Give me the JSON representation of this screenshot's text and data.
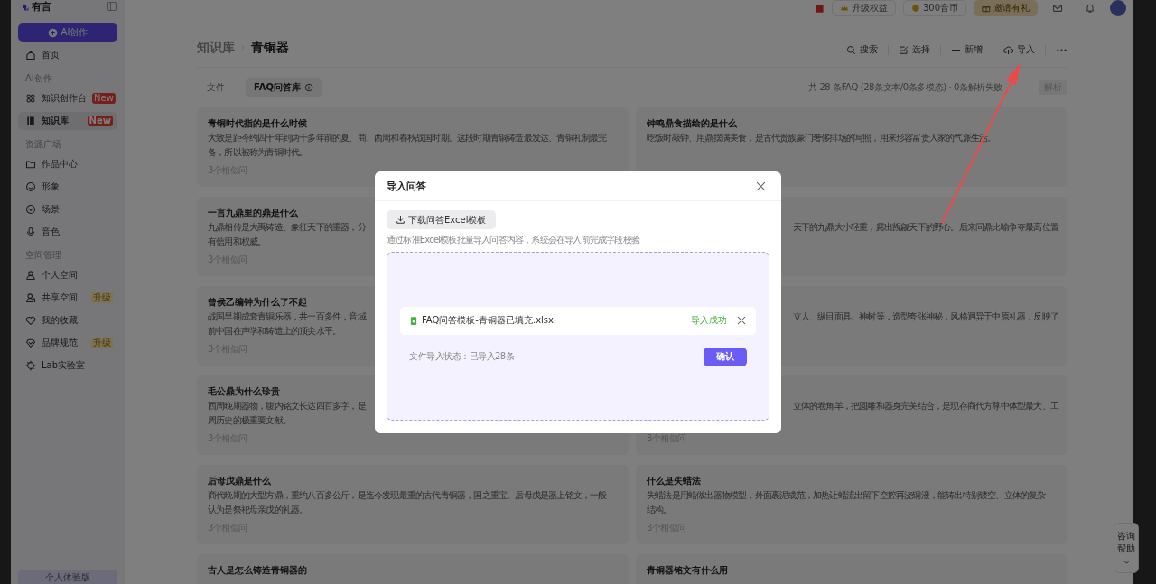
{
  "sidebar": {
    "logo": "有言",
    "create_button": "AI创作",
    "sections": [
      {
        "items": [
          {
            "label": "首页",
            "selected": false
          }
        ]
      },
      {
        "heading": "AI创作",
        "items": [
          {
            "label": "知识创作台",
            "selected": false,
            "badge": {
              "text": "New",
              "kind": "new"
            }
          },
          {
            "label": "知识库",
            "selected": true,
            "badge": {
              "text": "New",
              "kind": "new"
            }
          }
        ]
      },
      {
        "heading": "资源广场",
        "items": [
          {
            "label": "作品中心",
            "selected": false
          },
          {
            "label": "形象",
            "selected": false
          },
          {
            "label": "场景",
            "selected": false
          },
          {
            "label": "音色",
            "selected": false
          }
        ]
      },
      {
        "heading": "空间管理",
        "items": [
          {
            "label": "个人空间",
            "selected": false
          },
          {
            "label": "共享空间",
            "selected": false,
            "badge": {
              "text": "升级",
              "kind": "upgrade"
            }
          },
          {
            "label": "我的收藏",
            "selected": false
          },
          {
            "label": "品牌规范",
            "selected": false,
            "badge": {
              "text": "升级",
              "kind": "upgrade"
            }
          },
          {
            "label": "Lab实验室",
            "selected": false
          }
        ]
      }
    ],
    "plan": "个人体验版"
  },
  "top_bar": {
    "pills": [
      {
        "label": "升级权益",
        "kind": "plain"
      },
      {
        "label": "300音币",
        "kind": "plain"
      },
      {
        "label": "邀请有礼",
        "kind": "gold"
      }
    ]
  },
  "header": {
    "breadcrumb": [
      "知识库",
      "青铜器"
    ],
    "toolbar": [
      {
        "label": "搜索"
      },
      {
        "label": "选择"
      },
      {
        "label": "新增"
      },
      {
        "label": "导入"
      }
    ]
  },
  "tabs": [
    {
      "label": "文件",
      "selected": false
    },
    {
      "label": "FAQ问答库",
      "selected": true,
      "info": true
    }
  ],
  "stats": "共 28 条FAQ (28条文本/0条多模态) · 0条解析失败",
  "parse_button": {
    "label": "解析",
    "disabled": true
  },
  "cards": [
    {
      "title": "青铜时代指的是什么时候",
      "lines": [
        {
          "kind": "full",
          "text": "大致是距今约四千年到两千多年前的夏、商、西周和春秋战国时期。这段时期青铜铸造最发达、青铜礼制最完"
        },
        {
          "kind": "full",
          "text": "备，所以被称为青铜时代。"
        }
      ],
      "similar": "3个相似问"
    },
    {
      "title": "钟鸣鼎食描绘的是什么",
      "lines": [
        {
          "kind": "full",
          "text": "吃饭时敲钟、用鼎摆满美食，是古代贵族豪门奢侈排场的写照，用来形容富贵人家的气派生活。"
        }
      ]
    },
    {
      "title": "一言九鼎里的鼎是什么",
      "lines": [
        {
          "kind": "full",
          "text": "九鼎相传是大禹铸造、象征天下的重器，分"
        },
        {
          "kind": "full",
          "text": "有信用和权威。"
        }
      ],
      "similar": "3个相似问"
    },
    {
      "lines": [
        {
          "kind": "tail",
          "text": "天下的九鼎大小轻重，露出觊觎天下的野心。后来问鼎比喻争夺最高位置"
        }
      ]
    },
    {
      "title": "曾侯乙编钟为什么了不起",
      "lines": [
        {
          "kind": "full",
          "text": "战国早期成套青铜乐器，共一百多件，音域"
        },
        {
          "kind": "full",
          "text": "前中国在声学和铸造上的顶尖水平。"
        }
      ],
      "similar": "3个相似问"
    },
    {
      "lines": [
        {
          "kind": "tail",
          "text": "立人、纵目面具、神树等，造型夸张神秘，风格迥异于中原礼器，反映了"
        }
      ]
    },
    {
      "title": "毛公鼎为什么珍贵",
      "lines": [
        {
          "kind": "full",
          "text": "西周晚期器物，腹内铭文长达四百多字，是"
        },
        {
          "kind": "full",
          "text": "周历史的极重要文献。"
        }
      ],
      "similar": "3个相似问"
    },
    {
      "lines": [
        {
          "kind": "tail",
          "text": "立体的卷角羊，把圆雕和器身完美结合，是现存商代方尊中体型最大、工"
        }
      ],
      "similar": "3个相似问"
    },
    {
      "title": "后母戊鼎是什么",
      "lines": [
        {
          "kind": "full",
          "text": "商代晚期的大型方鼎，重约八百多公斤，是迄今发现最重的古代青铜器，国之重宝。后母戊是器上铭文，一般"
        },
        {
          "kind": "full",
          "text": "认为是祭祀母亲戊的礼器。"
        }
      ],
      "similar": "3个相似问"
    },
    {
      "title": "什么是失蜡法",
      "lines": [
        {
          "kind": "full",
          "text": "失蜡法是用蜡做出器物模型，外面裹泥成范，加热让蜡流出留下空腔再浇铜液，能铸出特别镂空、立体的复杂"
        },
        {
          "kind": "full",
          "text": "结构。"
        }
      ],
      "similar": "3个相似问"
    },
    {
      "title": "古人是怎么铸造青铜器的"
    },
    {
      "title": "青铜器铭文有什么用"
    }
  ],
  "help_widget": {
    "label": "咨询帮助"
  },
  "modal": {
    "title": "导入问答",
    "download_button": "下载问答Excel模板",
    "hint": "通过标准Excel模板批量导入问答内容，系统会在导入前完成字段校验",
    "file": {
      "name": "FAQ问答模板-青铜器已填充.xlsx",
      "status": "导入成功"
    },
    "import_status": "文件导入状态：已导入28条",
    "confirm_button": "确认"
  }
}
